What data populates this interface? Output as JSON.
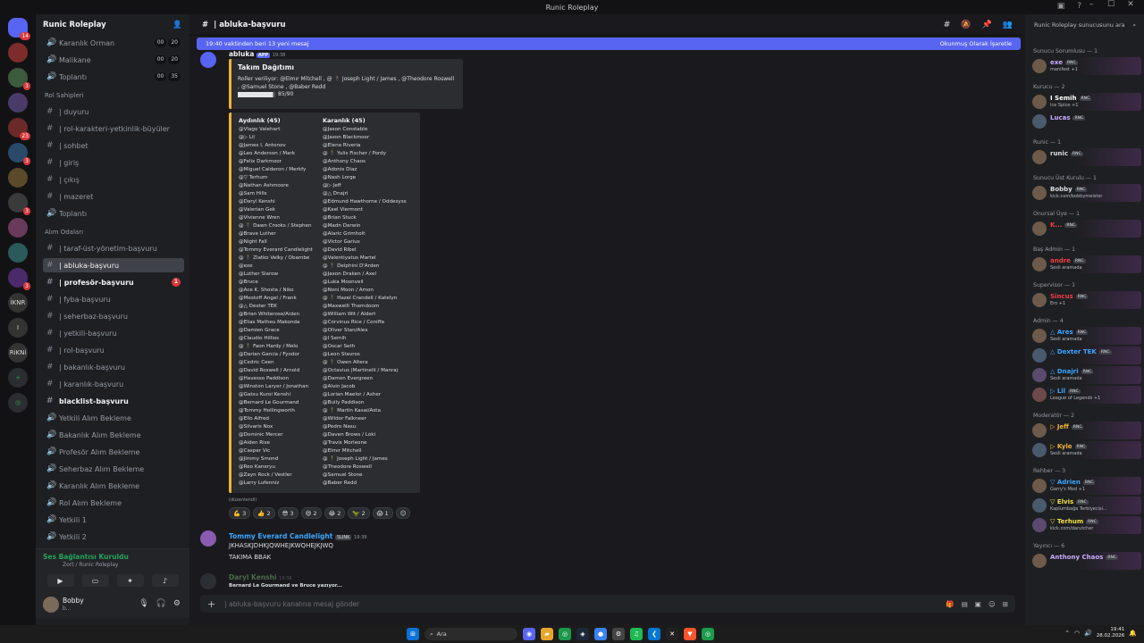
{
  "window": {
    "title": "Runic Roleplay",
    "controls": [
      "–",
      "☐",
      "✕"
    ]
  },
  "guilds": [
    {
      "label": "",
      "badge": "14"
    },
    {
      "label": "",
      "badge": ""
    },
    {
      "label": "",
      "badge": "3"
    },
    {
      "label": "",
      "badge": ""
    },
    {
      "label": "",
      "badge": "23"
    },
    {
      "label": "",
      "badge": "3"
    },
    {
      "label": "",
      "badge": ""
    },
    {
      "label": "",
      "badge": "3"
    },
    {
      "label": "",
      "badge": ""
    },
    {
      "label": "",
      "badge": ""
    },
    {
      "label": "",
      "badge": "3"
    },
    {
      "label": "İKNR",
      "badge": ""
    },
    {
      "label": "I",
      "badge": ""
    },
    {
      "label": "RiKNi",
      "badge": ""
    }
  ],
  "server": {
    "name": "Runic Roleplay"
  },
  "channels_top": [
    {
      "name": "Karanlık Orman",
      "c1": "00",
      "c2": "20"
    },
    {
      "name": "Malikane",
      "c1": "00",
      "c2": "20"
    },
    {
      "name": "Toplantı",
      "c1": "00",
      "c2": "35"
    }
  ],
  "categories": {
    "rol": "Rol Sahipleri",
    "alim": "Alım Odaları"
  },
  "channels_rol": [
    "| duyuru",
    "| rol-karakteri-yetkinlik-büyüler",
    "| sohbet",
    "| giriş",
    "| çıkış",
    "| mazeret",
    "Toplantı"
  ],
  "channels_alim": [
    "| taraf-üst-yönetim-başvuru",
    "| abluka-başvuru",
    "| profesör-başvuru",
    "| fyba-başvuru",
    "| seherbaz-başvuru",
    "| yetkili-başvuru",
    "| rol-başvuru",
    "| bakanlık-başvuru",
    "| karanlık-başvuru",
    "blacklist-başvuru"
  ],
  "channels_voice": [
    "Yetkili Alım Bekleme",
    "Bakanlık Alım Bekleme",
    "Profesör Alım Bekleme",
    "Seherbaz Alım Bekleme",
    "Karanlık Alım Bekleme",
    "Rol Alım Bekleme",
    "Yetkili 1",
    "Yetkili 2"
  ],
  "unread_badge": "1",
  "voice": {
    "title": "Ses Bağlantısı Kuruldu",
    "sub": "Zort / Runic Roleplay"
  },
  "user": {
    "name": "Bobby",
    "status": "b..."
  },
  "chat": {
    "channel": "| abluka-başvuru",
    "newbar": "19:40 vaktinden beri 13 yeni mesaj",
    "markread": "Okunmuş Olarak İşaretle",
    "bot_author": "abluka",
    "bot_tag": "APP",
    "bot_time": "19:38",
    "embed_title": "Takım Dağıtımı",
    "embed_desc": "Roller veriliyor: @Elmır Mitchell , @ 🕴 Joseph Light / James , @Theodore Roswell , @Samuel Stone , @Baber Redd",
    "progress": "85/90",
    "progress_fraction": 0.944,
    "team_a_title": "Aydınlık (45)",
    "team_b_title": "Karanlık (45)",
    "team_a": [
      "@Vlago Valehart",
      "@▷ Lil",
      "@James I. Antonov",
      "@Leo Anderson / Mark",
      "@Felix Darkmoor",
      "@Miguel Calderon / Merkfy",
      "@▽ Terhum",
      "@Nathan Ashmoore",
      "@Sam Hills",
      "@Daryl Kenshi",
      "@Valerian Gek",
      "@Vivienne Wren",
      "@ 🕴 Dawn Crooks / Stephen",
      "@Brave Luther",
      "@Night Fall",
      "@Tommy Everard Candlelight",
      "@ 🕴 Zlatko Velky / Obambe",
      "@exe",
      "@Luther Slarow",
      "@Bruce",
      "@Ace K. Shosta / Niko",
      "@Mestoff Angel / Frank",
      "@△ Dexter TEK",
      "@Brian Whiterose/Aiden",
      "@Elias Matheu Makonda",
      "@Damien Grace",
      "@Claudio Hillios",
      "@ 🕴 Faon Hardy / Melo",
      "@Darian Garcia / Fyodor",
      "@Cedric Ceen",
      "@David Roswell / Arnold",
      "@Havesso Paddison",
      "@Winston Laryer / Jonathan",
      "@Gatsu Kuroi Kenshi",
      "@Bernard Le Gourmand",
      "@Tommy Hollingworth",
      "@Ello Alfred",
      "@Silvaris Nox",
      "@Dominic Mercer",
      "@Aiden Rise",
      "@Casper Vic",
      "@Jimmy Smond",
      "@Reo Kaneryu",
      "@Zayn Rock / Vestler",
      "@Larry Lufenniz"
    ],
    "team_b": [
      "@Jason Constable",
      "@Jaxon Blackmoor",
      "@Elena Riveria",
      "@ 🕴 Yulis Fischer / Pordy",
      "@Anthony Chaos",
      "@Adonis Diaz",
      "@Nash Lorge",
      "@▷ Jeff",
      "@△ Dnajri",
      "@Edmund Hawthorne / Oddesyss",
      "@Kael Viermont",
      "@Brian Stuck",
      "@Madn Darwin",
      "@Alaric Grimholt",
      "@Victor Garius",
      "@David Ribel",
      "@Valentiyatus Martel",
      "@ 🕴 Delphini D'Arden",
      "@Jaxon Draken / Axel",
      "@Luka Moonveil",
      "@Noni Moon / Amon",
      "@ 🕴 Hazel Crandell / Katelyn",
      "@Maxwelll Themdoom",
      "@William Wit / Aldert",
      "@Corvinus Rice / Coniffa",
      "@Oliver Stan/Alex",
      "@I Semih",
      "@Oscar Seth",
      "@Leon Stavros",
      "@ 🕴 Owen Altera",
      "@Octavius |Martinelli / Manraj",
      "@Damon Evergreen",
      "@Alvin Jacob",
      "@Lorian Maelor / Asher",
      "@Bully Paddison",
      "@ 🕴 Martin Kasai/Asta",
      "@Wildor Falkneer",
      "@Pedro Nasu",
      "@Daven Brows / Loki",
      "@Travis Morleone",
      "@Elmır Mitchell",
      "@ 🕴 Joseph Light / James",
      "@Theodore Roswell",
      "@Samuel Stone",
      "@Baber Redd"
    ],
    "edited": "(düzenlendi)",
    "reactions": [
      "💪 3",
      "👍 2",
      "😎 3",
      "😄 2",
      "😂 2",
      "🦖 2",
      "😱 1",
      "☺"
    ],
    "msg2_author": "Tommy Everard Candlelight",
    "msg2_tag": "SLINK",
    "msg2_time": "19:39",
    "msg2_line1": "JKHASKJDHKJQWHEJKWQHEJKJWQ",
    "msg2_line2": "TAKIMA BBAK",
    "msg3_author": "Daryl Kenshi",
    "msg3_time": "19:38",
    "typing": "Bernard Le Gourmand ve Bruce yazıyor...",
    "composer_placeholder": "| abluka-başvuru kanalına mesaj gönder"
  },
  "members": {
    "search": "Runic Roleplay sunucusunu ara",
    "groups": [
      {
        "role": "Sunucu Sorumlusu — 1",
        "members": [
          {
            "name": "exe",
            "status": "manifest +1",
            "color": "#c9a9ff"
          }
        ]
      },
      {
        "role": "Kurucu — 2",
        "members": [
          {
            "name": "I Semih",
            "status": "Ice Spice +1",
            "color": "#ffffff"
          },
          {
            "name": "Lucas",
            "status": "",
            "color": "#c9a9ff"
          }
        ]
      },
      {
        "role": "Runic — 1",
        "members": [
          {
            "name": "runic",
            "status": "",
            "color": "#dbdee1"
          }
        ]
      },
      {
        "role": "Sunucu Üst Kurulu — 1",
        "members": [
          {
            "name": "Bobby",
            "status": "kick.com/bobbymeister",
            "color": "#dbdee1"
          }
        ]
      },
      {
        "role": "Onursal Üye — 1",
        "members": [
          {
            "name": "K...",
            "status": "",
            "color": "#f23f42"
          }
        ]
      },
      {
        "role": "Baş Admin — 1",
        "members": [
          {
            "name": "andre",
            "status": "Sesli aramada",
            "color": "#f23f42"
          }
        ]
      },
      {
        "role": "Supervisor — 1",
        "members": [
          {
            "name": "Sincus",
            "status": "Ero +1",
            "color": "#f23f42"
          }
        ]
      },
      {
        "role": "Admin — 4",
        "members": [
          {
            "name": "△ Ares",
            "status": "Sesli aramada",
            "color": "#3ba6ff"
          },
          {
            "name": "△ Dexter TEK",
            "status": "",
            "color": "#3ba6ff"
          },
          {
            "name": "△ Dnajri",
            "status": "Sesli aramada",
            "color": "#3ba6ff"
          },
          {
            "name": "▷ Lil",
            "status": "League of Legends +1",
            "color": "#3ba6ff"
          }
        ]
      },
      {
        "role": "Moderatör — 2",
        "members": [
          {
            "name": "▷ Jeff",
            "status": "",
            "color": "#f0b232"
          },
          {
            "name": "▷ Kyle",
            "status": "Sesli aramada",
            "color": "#f0b232"
          }
        ]
      },
      {
        "role": "Rehber — 3",
        "members": [
          {
            "name": "▽ Adrien",
            "status": "Garry's Mod +1",
            "color": "#3ba6ff"
          },
          {
            "name": "▽ Elvis",
            "status": "Kaplumbağa Terbiyecisi...",
            "color": "#f0e040"
          },
          {
            "name": "▽ Terhum",
            "status": "kick.com/darutcher",
            "color": "#f0e040"
          }
        ]
      },
      {
        "role": "Yayıncı — 6",
        "members": [
          {
            "name": "Anthony Chaos",
            "status": "",
            "color": "#c9a9ff"
          }
        ]
      }
    ]
  },
  "taskbar": {
    "search": "Ara",
    "time": "19:41",
    "date": "28.02.2026"
  }
}
